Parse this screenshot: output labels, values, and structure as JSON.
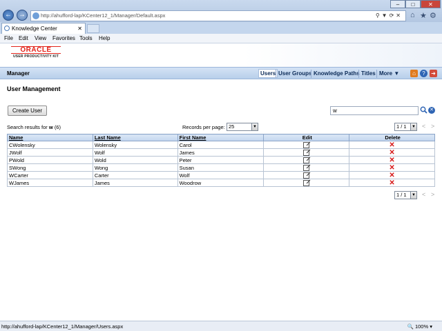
{
  "browser": {
    "url": "http://ahufford-lap/KCenter12_1/Manager/Default.aspx",
    "tab_title": "Knowledge Center",
    "menu": [
      "File",
      "Edit",
      "View",
      "Favorites",
      "Tools",
      "Help"
    ],
    "status_url": "http://ahufford-lap/KCenter12_1/Manager/Users.aspx",
    "zoom": "100%"
  },
  "header": {
    "logo_brand": "ORACLE",
    "logo_product": "USER PRODUCTIVITY KIT"
  },
  "navbar": {
    "section": "Manager",
    "links": [
      "Users",
      "User Groups",
      "Knowledge Paths",
      "Titles",
      "More ▼"
    ],
    "active": "Users"
  },
  "page": {
    "title": "User Management",
    "create_button": "Create User",
    "search_value": "w",
    "results_prefix": "Search results for",
    "results_term": "w",
    "results_count": "(6)",
    "records_per_page_label": "Records per page:",
    "records_per_page": "25",
    "page_indicator": "1 / 1"
  },
  "table": {
    "headers": [
      "Name",
      "Last Name",
      "First Name",
      "Edit",
      "Delete"
    ],
    "rows": [
      {
        "name": "CWolensky",
        "last": "Wolensky",
        "first": "Carol"
      },
      {
        "name": "JWolf",
        "last": "Wolf",
        "first": "James"
      },
      {
        "name": "PWold",
        "last": "Wold",
        "first": "Peter"
      },
      {
        "name": "SWong",
        "last": "Wong",
        "first": "Susan"
      },
      {
        "name": "WCarter",
        "last": "Carter",
        "first": "Wolf"
      },
      {
        "name": "WJames",
        "last": "James",
        "first": "Woodrow"
      }
    ]
  },
  "colors": {
    "accent": "#b8cfea",
    "delete": "#d61818",
    "oracle_red": "#e2231a"
  }
}
